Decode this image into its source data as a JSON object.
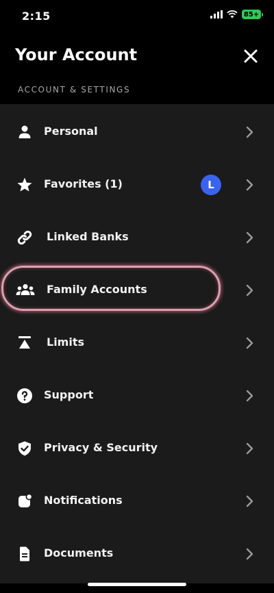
{
  "status_bar": {
    "time": "2:15",
    "battery": "85+"
  },
  "header": {
    "title": "Your Account"
  },
  "section": {
    "label": "ACCOUNT & SETTINGS"
  },
  "menu": [
    {
      "label": "Personal",
      "icon": "person-icon"
    },
    {
      "label": "Favorites (1)",
      "icon": "star-icon",
      "badge": "L"
    },
    {
      "label": "Linked Banks",
      "icon": "link-icon"
    },
    {
      "label": "Family Accounts",
      "icon": "family-icon"
    },
    {
      "label": "Limits",
      "icon": "limits-icon"
    },
    {
      "label": "Support",
      "icon": "question-icon",
      "highlighted": true
    },
    {
      "label": "Privacy & Security",
      "icon": "shield-check-icon"
    },
    {
      "label": "Notifications",
      "icon": "notification-icon"
    },
    {
      "label": "Documents",
      "icon": "document-icon"
    }
  ],
  "colors": {
    "background": "#000000",
    "list_background": "#1b1b1b",
    "avatar": "#3a63f0",
    "highlight_ring": "#dca0ae",
    "battery": "#35c759"
  }
}
